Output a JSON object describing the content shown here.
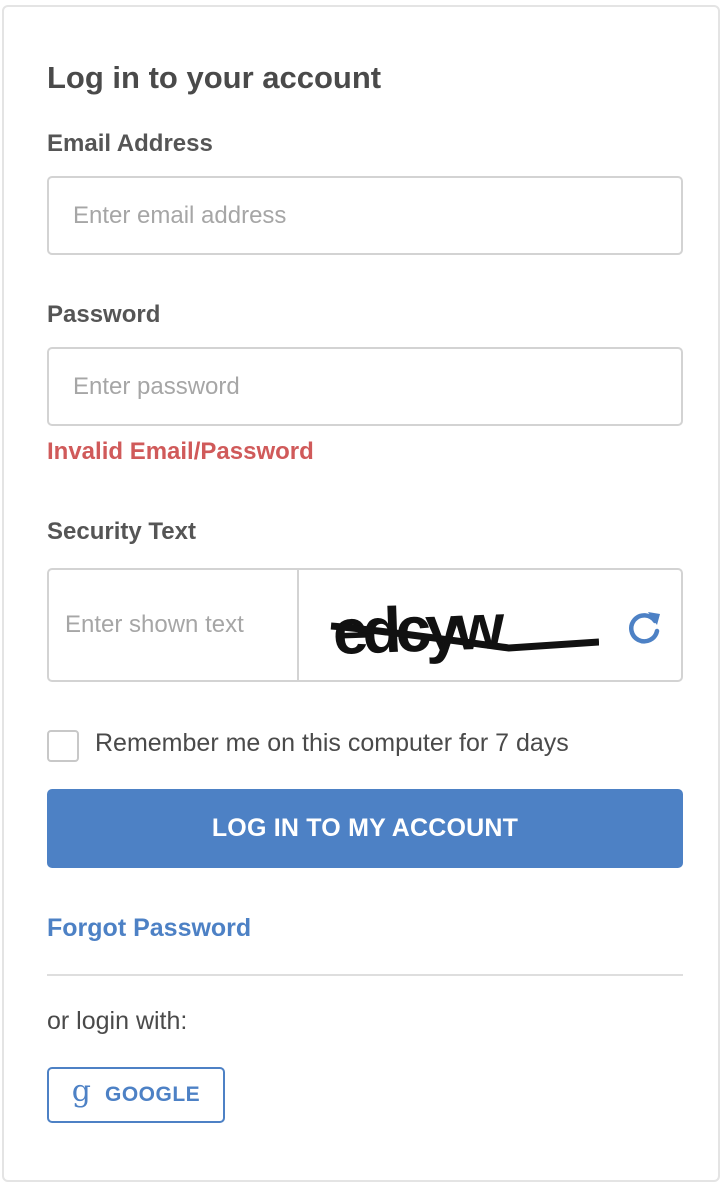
{
  "form": {
    "title": "Log in to your account",
    "email": {
      "label": "Email Address",
      "placeholder": "Enter email address",
      "value": ""
    },
    "password": {
      "label": "Password",
      "placeholder": "Enter password",
      "value": ""
    },
    "error_message": "Invalid Email/Password",
    "security": {
      "label": "Security Text",
      "placeholder": "Enter shown text",
      "captcha_text": "edcyw",
      "refresh_icon": "refresh-icon"
    },
    "remember": {
      "label": "Remember me on this computer for 7 days",
      "checked": false
    },
    "submit_label": "LOG IN TO MY ACCOUNT",
    "forgot_label": "Forgot Password",
    "alt_login_label": "or login with:",
    "google": {
      "icon": "g",
      "label": "GOOGLE"
    }
  },
  "colors": {
    "accent": "#4d81c5",
    "error": "#d05a5a",
    "text": "#4a4a4a",
    "border": "#d3d3d3"
  }
}
